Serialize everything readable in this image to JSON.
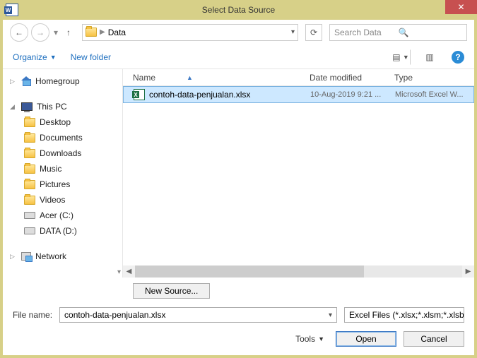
{
  "window": {
    "title": "Select Data Source"
  },
  "nav": {
    "current_folder": "Data"
  },
  "search": {
    "placeholder": "Search Data"
  },
  "toolbar": {
    "organize": "Organize",
    "new_folder": "New folder"
  },
  "sidebar": {
    "homegroup": "Homegroup",
    "this_pc": "This PC",
    "items": [
      {
        "label": "Desktop"
      },
      {
        "label": "Documents"
      },
      {
        "label": "Downloads"
      },
      {
        "label": "Music"
      },
      {
        "label": "Pictures"
      },
      {
        "label": "Videos"
      },
      {
        "label": "Acer (C:)"
      },
      {
        "label": "DATA (D:)"
      }
    ],
    "network": "Network"
  },
  "columns": {
    "name": "Name",
    "date": "Date modified",
    "type": "Type"
  },
  "files": [
    {
      "name": "contoh-data-penjualan.xlsx",
      "date": "10-Aug-2019 9:21 ...",
      "type": "Microsoft Excel W..."
    }
  ],
  "footer": {
    "new_source": "New Source...",
    "file_name_label": "File name:",
    "file_name_value": "contoh-data-penjualan.xlsx",
    "filter": "Excel Files (*.xlsx;*.xlsm;*.xlsb;*.",
    "tools": "Tools",
    "open": "Open",
    "cancel": "Cancel"
  }
}
